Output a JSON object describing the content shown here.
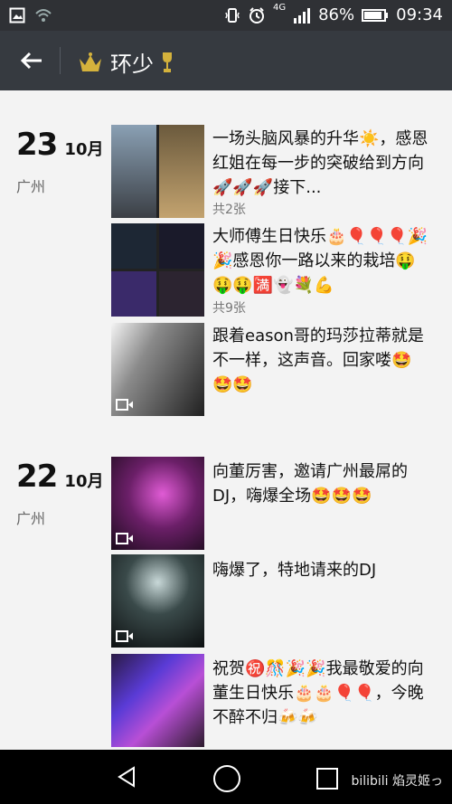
{
  "status": {
    "network": "4G",
    "battery": "86%",
    "time": "09:34"
  },
  "appbar": {
    "title": "环少"
  },
  "groups": [
    {
      "day": "23",
      "month": "10月",
      "city": "广州",
      "posts": [
        {
          "text": "一场头脑风暴的升华☀️，感恩红姐在每一步的突破给到方向🚀🚀🚀接下...",
          "count": "共2张"
        },
        {
          "text": "大师傅生日快乐🎂🎈🎈🎈🎉🎉感恩你一路以来的栽培🤑🤑🤑🈵👻💐💪",
          "count": "共9张"
        },
        {
          "text": "跟着eason哥的玛莎拉蒂就是不一样，这声音。回家喽🤩🤩🤩",
          "count": ""
        }
      ]
    },
    {
      "day": "22",
      "month": "10月",
      "city": "广州",
      "posts": [
        {
          "text": "向董厉害，邀请广州最屌的DJ，嗨爆全场🤩🤩🤩",
          "count": ""
        },
        {
          "text": "嗨爆了，特地请来的DJ",
          "count": ""
        },
        {
          "text": "祝贺㊗️🎊🎉🎉我最敬爱的向董生日快乐🎂🎂🎈🎈，今晚不醉不归🍻🍻",
          "count": ""
        }
      ]
    }
  ],
  "watermark": "bilibili 焰灵姬っ",
  "icons": {
    "back": "arrow-left-icon",
    "crown": "crown-icon",
    "trophy": "trophy-icon",
    "video": "video-camera-icon",
    "wifi": "wifi-icon",
    "image": "image-icon",
    "signal": "signal-icon",
    "alarm": "alarm-icon",
    "vibrate": "vibrate-icon"
  }
}
